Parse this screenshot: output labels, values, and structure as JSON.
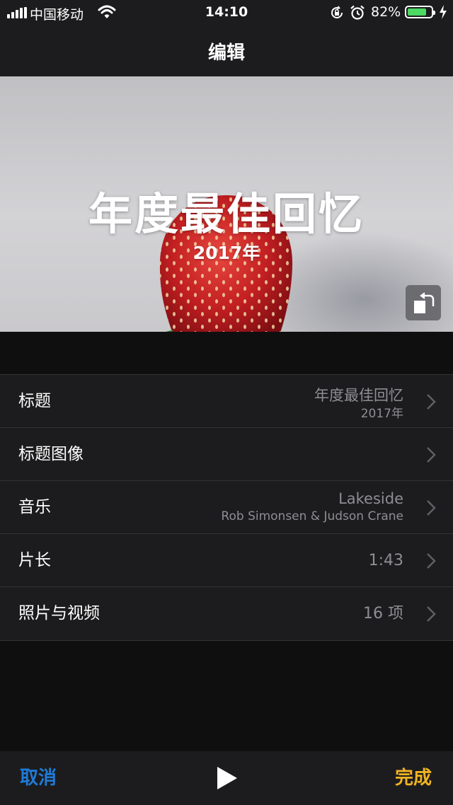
{
  "status_bar": {
    "carrier": "中国移动",
    "time": "14:10",
    "battery_percent": "82%",
    "battery_level": 0.82,
    "battery_color": "#4cd964",
    "icons": [
      "signal-icon",
      "wifi-icon",
      "orientation-lock-icon",
      "alarm-icon",
      "battery-icon",
      "charging-bolt-icon"
    ]
  },
  "nav": {
    "title": "编辑"
  },
  "hero": {
    "title": "年度最佳回忆",
    "subtitle": "2017年",
    "rotate_icon": "rotate-icon"
  },
  "list": {
    "rows": [
      {
        "label": "标题",
        "value": "年度最佳回忆",
        "detail": "2017年"
      },
      {
        "label": "标题图像",
        "value": "",
        "detail": ""
      },
      {
        "label": "音乐",
        "value": "Lakeside",
        "detail": "Rob Simonsen & Judson Crane"
      },
      {
        "label": "片长",
        "value": "1:43",
        "detail": ""
      },
      {
        "label": "照片与视频",
        "value": "16 项",
        "detail": ""
      }
    ]
  },
  "toolbar": {
    "cancel": "取消",
    "done": "完成",
    "play_icon": "play-icon",
    "cancel_color": "#1e7bd8",
    "done_color": "#f0b323"
  }
}
